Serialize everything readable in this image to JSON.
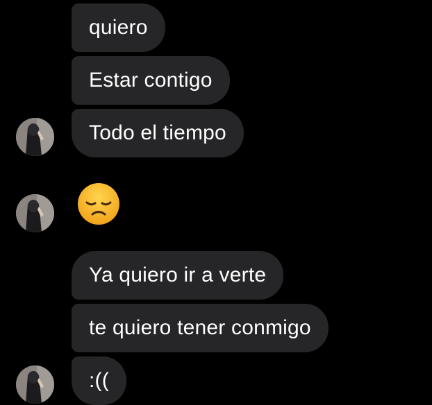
{
  "conversation": {
    "messages": [
      {
        "text": "quiero"
      },
      {
        "text": "Estar contigo"
      },
      {
        "text": "Todo el tiempo"
      },
      {
        "text": "😞",
        "emoji": "disappointed-face"
      },
      {
        "text": "Ya quiero ir a verte"
      },
      {
        "text": "te quiero tener conmigo"
      },
      {
        "text": ":(("
      }
    ]
  },
  "theme": {
    "background": "#000000",
    "bubble_color": "#262628",
    "text_color": "#ffffff",
    "emoji_color": "#f8b52c"
  }
}
